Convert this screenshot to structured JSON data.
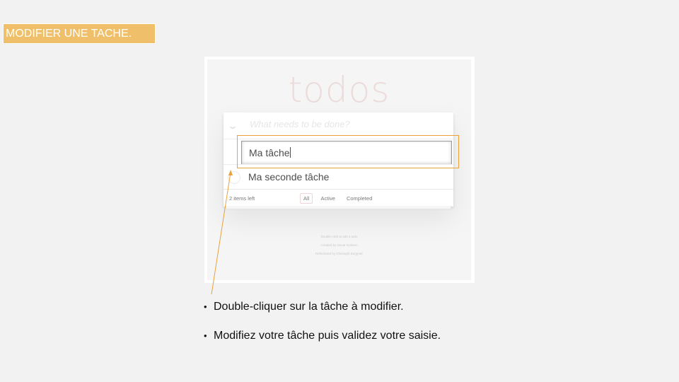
{
  "slide": {
    "title": "MODIFIER UNE TACHE.",
    "bullets": [
      "Double-cliquer sur la tâche à modifier.",
      "Modifiez votre tâche puis validez votre saisie."
    ]
  },
  "todo_app": {
    "logo": "todos",
    "new_todo_placeholder": "What needs to be done?",
    "toggle_all_icon": "chevron-down-icon",
    "editing_value": "Ma tâche",
    "items": [
      {
        "label": "Ma seconde tâche",
        "completed": false
      }
    ],
    "footer": {
      "count": "2 items left",
      "filters": [
        "All",
        "Active",
        "Completed"
      ],
      "selected_filter": "All"
    },
    "info": [
      "Double-click to edit a todo",
      "Created by Oscar Godson",
      "Refactored by Christoph Burgmer"
    ]
  },
  "colors": {
    "title_background": "#efbf6a",
    "highlight_border": "#e9a23b",
    "slide_background": "#f2f2f2"
  }
}
